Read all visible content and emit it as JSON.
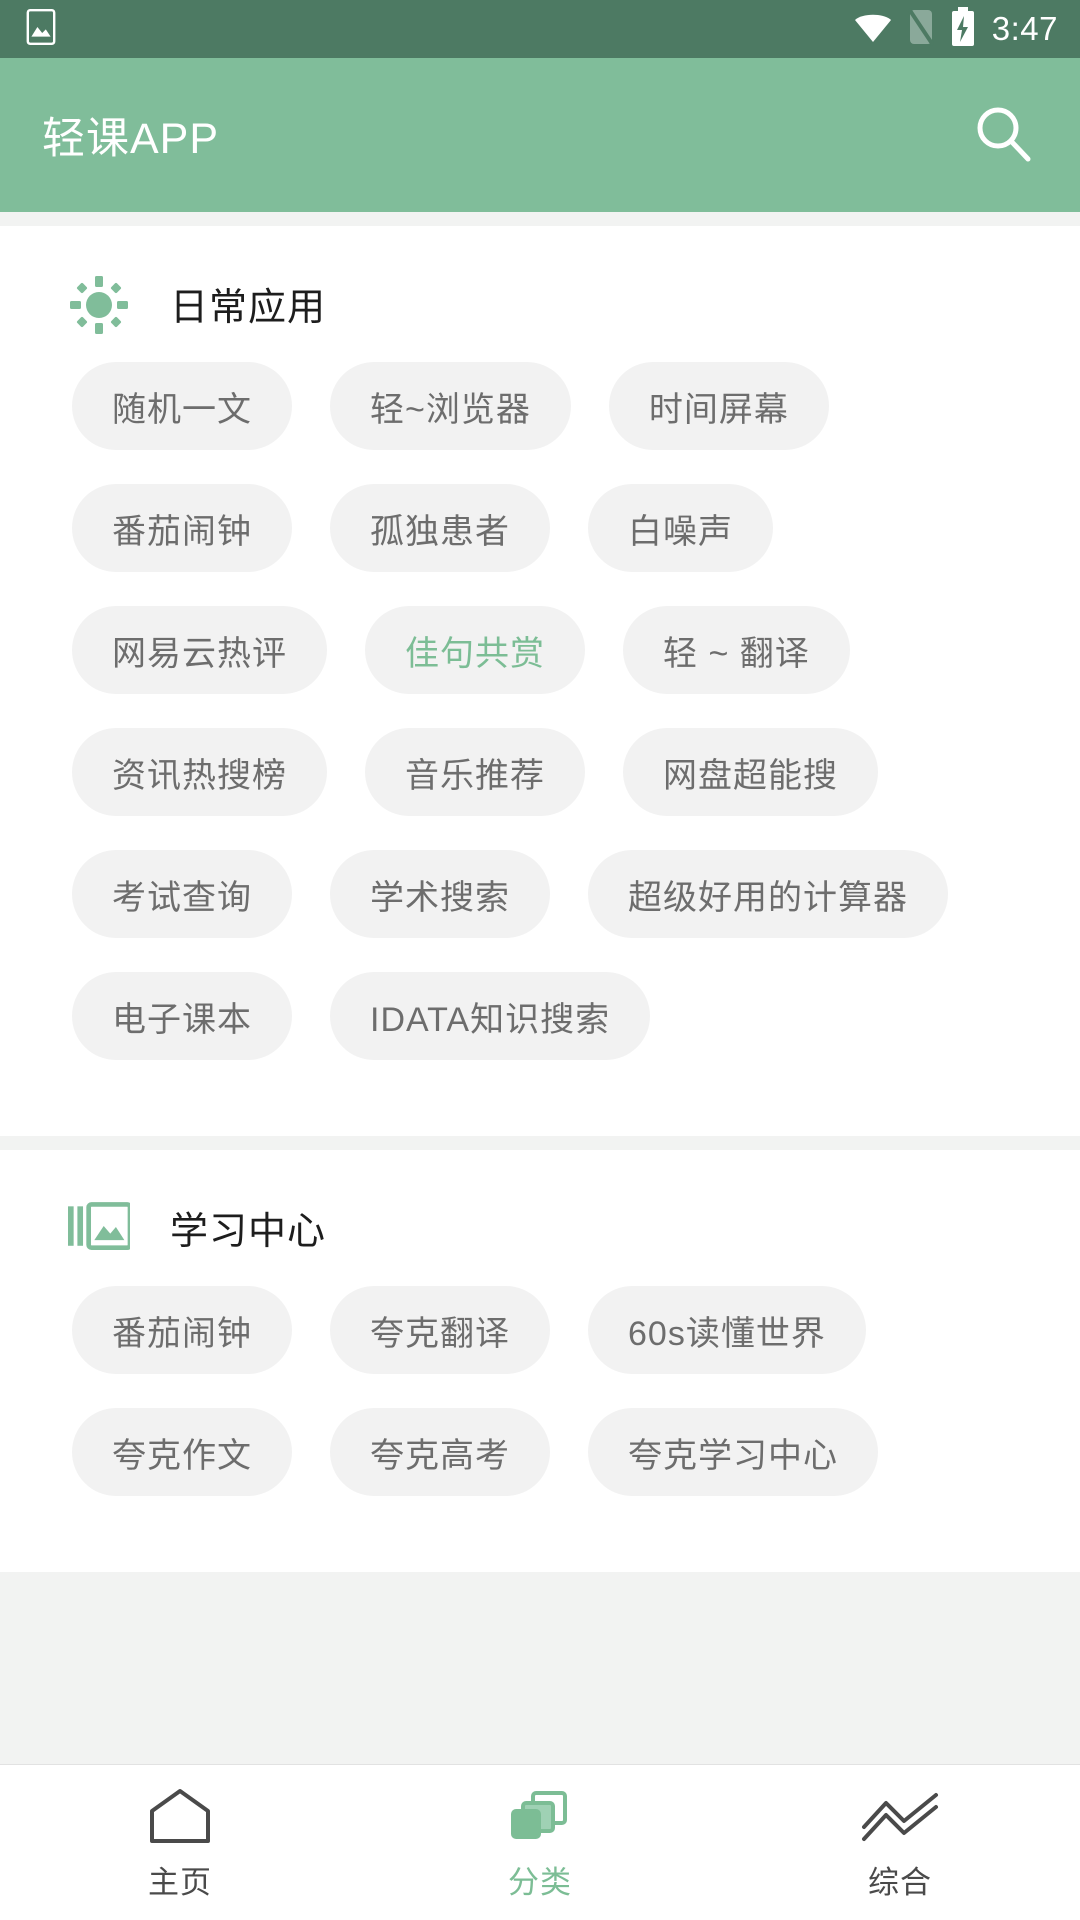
{
  "status_bar": {
    "time": "3:47",
    "icons": [
      "image-icon",
      "wifi-icon",
      "no-sim-icon",
      "battery-charging-icon"
    ],
    "background_color": "#4d7a63"
  },
  "app_bar": {
    "title": "轻课APP",
    "search_icon": "search-icon",
    "background_color": "#80bd9a"
  },
  "theme": {
    "accent": "#7cbd95",
    "chip_bg": "#f2f2f2",
    "chip_text": "#6d6d6d"
  },
  "sections": [
    {
      "icon": "brightness-sun-icon",
      "title": "日常应用",
      "chips": [
        {
          "label": "随机一文",
          "highlighted": false
        },
        {
          "label": "轻~浏览器",
          "highlighted": false
        },
        {
          "label": "时间屏幕",
          "highlighted": false
        },
        {
          "label": "番茄闹钟",
          "highlighted": false
        },
        {
          "label": "孤独患者",
          "highlighted": false
        },
        {
          "label": "白噪声",
          "highlighted": false
        },
        {
          "label": "网易云热评",
          "highlighted": false
        },
        {
          "label": "佳句共赏",
          "highlighted": true
        },
        {
          "label": "轻 ~ 翻译",
          "highlighted": false
        },
        {
          "label": "资讯热搜榜",
          "highlighted": false
        },
        {
          "label": "音乐推荐",
          "highlighted": false
        },
        {
          "label": "网盘超能搜",
          "highlighted": false
        },
        {
          "label": "考试查询",
          "highlighted": false
        },
        {
          "label": "学术搜索",
          "highlighted": false
        },
        {
          "label": "超级好用的计算器",
          "highlighted": false
        },
        {
          "label": "电子课本",
          "highlighted": false
        },
        {
          "label": "IDATA知识搜索",
          "highlighted": false
        }
      ]
    },
    {
      "icon": "image-chart-icon",
      "title": "学习中心",
      "chips": [
        {
          "label": "番茄闹钟",
          "highlighted": false
        },
        {
          "label": "夸克翻译",
          "highlighted": false
        },
        {
          "label": "60s读懂世界",
          "highlighted": false
        },
        {
          "label": "夸克作文",
          "highlighted": false
        },
        {
          "label": "夸克高考",
          "highlighted": false
        },
        {
          "label": "夸克学习中心",
          "highlighted": false
        }
      ]
    }
  ],
  "bottom_nav": {
    "items": [
      {
        "label": "主页",
        "icon": "home-icon",
        "active": false
      },
      {
        "label": "分类",
        "icon": "layers-icon",
        "active": true
      },
      {
        "label": "综合",
        "icon": "chart-line-icon",
        "active": false
      }
    ]
  }
}
